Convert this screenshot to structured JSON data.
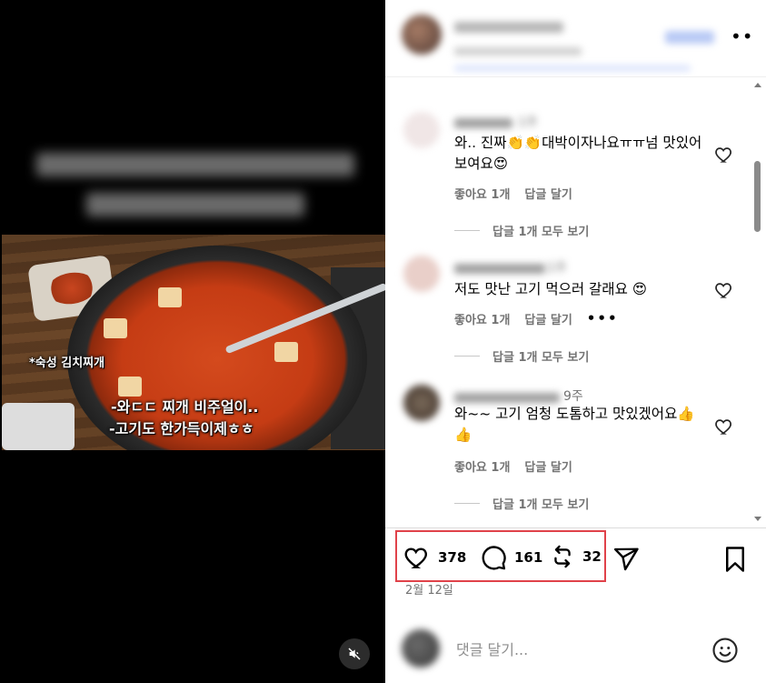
{
  "video": {
    "caption_small": "*숙성 김치찌개",
    "caption_line1": "-와ㄷㄷ 찌개 비주얼이..",
    "caption_line2": "-고기도 한가득이제ㅎㅎ",
    "mute_icon": "speaker-muted-icon"
  },
  "header": {
    "more_icon": "more-horizontal-icon"
  },
  "comments": [
    {
      "time": "1주",
      "text": "와.. 진짜👏👏대박이자나요ㅠㅠ넘 맛있어보여요😍",
      "like_label": "좋아요 1개",
      "reply_label": "답글 달기",
      "view_replies": "답글 1개 모두 보기"
    },
    {
      "time": "1주",
      "text": "저도 맛난 고기 먹으러 갈래요 😍",
      "like_label": "좋아요 1개",
      "reply_label": "답글 달기",
      "more_label": "•••",
      "view_replies": "답글 1개 모두 보기"
    },
    {
      "time": "9주",
      "text": "와~~ 고기 엄청 도톰하고 맛있겠어요👍👍",
      "like_label": "좋아요 1개",
      "reply_label": "답글 달기",
      "view_replies": "답글 1개 모두 보기"
    }
  ],
  "actions": {
    "like_count": "378",
    "comment_count": "161",
    "repost_count": "32",
    "like_icon": "heart-icon",
    "comment_icon": "comment-bubble-icon",
    "repost_icon": "repost-icon",
    "share_icon": "send-icon",
    "save_icon": "bookmark-icon",
    "highlight_color": "#e0424a"
  },
  "post_date": "2월 12일",
  "add_comment": {
    "placeholder": "댓글 달기...",
    "emoji_icon": "smiley-icon"
  }
}
